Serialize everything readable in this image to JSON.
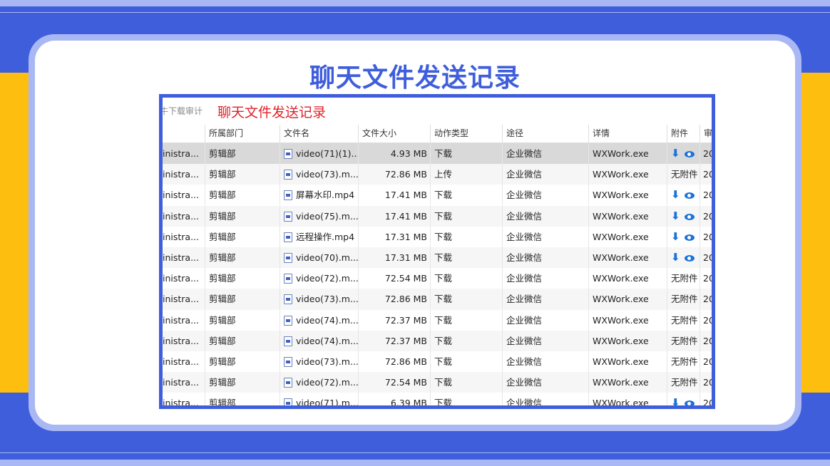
{
  "slide_title": "聊天文件发送记录",
  "app": {
    "breadcrumb": "牛下载审计",
    "annotation_label": "聊天文件发送记录"
  },
  "columns": [
    "",
    "所属部门",
    "文件名",
    "文件大小",
    "动作类型",
    "途径",
    "详情",
    "附件",
    "审"
  ],
  "rows": [
    {
      "user": "inistra...",
      "dept": "剪辑部",
      "file": "video(71)(1)....",
      "size": "4.93 MB",
      "action": "下载",
      "channel": "企业微信",
      "detail": "WXWork.exe",
      "attachment": "",
      "attachment_icons": true,
      "time": "20"
    },
    {
      "user": "inistra...",
      "dept": "剪辑部",
      "file": "video(73).m...",
      "size": "72.86 MB",
      "action": "上传",
      "channel": "企业微信",
      "detail": "WXWork.exe",
      "attachment": "无附件",
      "attachment_icons": false,
      "time": "20"
    },
    {
      "user": "inistra...",
      "dept": "剪辑部",
      "file": "屏幕水印.mp4",
      "size": "17.41 MB",
      "action": "下载",
      "channel": "企业微信",
      "detail": "WXWork.exe",
      "attachment": "",
      "attachment_icons": true,
      "time": "20"
    },
    {
      "user": "inistra...",
      "dept": "剪辑部",
      "file": "video(75).m...",
      "size": "17.41 MB",
      "action": "下载",
      "channel": "企业微信",
      "detail": "WXWork.exe",
      "attachment": "",
      "attachment_icons": true,
      "time": "20"
    },
    {
      "user": "inistra...",
      "dept": "剪辑部",
      "file": "远程操作.mp4",
      "size": "17.31 MB",
      "action": "下载",
      "channel": "企业微信",
      "detail": "WXWork.exe",
      "attachment": "",
      "attachment_icons": true,
      "time": "20"
    },
    {
      "user": "inistra...",
      "dept": "剪辑部",
      "file": "video(70).m...",
      "size": "17.31 MB",
      "action": "下载",
      "channel": "企业微信",
      "detail": "WXWork.exe",
      "attachment": "",
      "attachment_icons": true,
      "time": "20"
    },
    {
      "user": "inistra...",
      "dept": "剪辑部",
      "file": "video(72).m...",
      "size": "72.54 MB",
      "action": "下载",
      "channel": "企业微信",
      "detail": "WXWork.exe",
      "attachment": "无附件",
      "attachment_icons": false,
      "time": "20"
    },
    {
      "user": "inistra...",
      "dept": "剪辑部",
      "file": "video(73).m...",
      "size": "72.86 MB",
      "action": "下载",
      "channel": "企业微信",
      "detail": "WXWork.exe",
      "attachment": "无附件",
      "attachment_icons": false,
      "time": "20"
    },
    {
      "user": "inistra...",
      "dept": "剪辑部",
      "file": "video(74).m...",
      "size": "72.37 MB",
      "action": "下载",
      "channel": "企业微信",
      "detail": "WXWork.exe",
      "attachment": "无附件",
      "attachment_icons": false,
      "time": "20"
    },
    {
      "user": "inistra...",
      "dept": "剪辑部",
      "file": "video(74).m...",
      "size": "72.37 MB",
      "action": "下载",
      "channel": "企业微信",
      "detail": "WXWork.exe",
      "attachment": "无附件",
      "attachment_icons": false,
      "time": "20"
    },
    {
      "user": "inistra...",
      "dept": "剪辑部",
      "file": "video(73).m...",
      "size": "72.86 MB",
      "action": "下载",
      "channel": "企业微信",
      "detail": "WXWork.exe",
      "attachment": "无附件",
      "attachment_icons": false,
      "time": "20"
    },
    {
      "user": "inistra...",
      "dept": "剪辑部",
      "file": "video(72).m...",
      "size": "72.54 MB",
      "action": "下载",
      "channel": "企业微信",
      "detail": "WXWork.exe",
      "attachment": "无附件",
      "attachment_icons": false,
      "time": "20"
    },
    {
      "user": "inistra...",
      "dept": "剪辑部",
      "file": "video(71).m...",
      "size": "6.39 MB",
      "action": "下载",
      "channel": "企业微信",
      "detail": "WXWork.exe",
      "attachment": "",
      "attachment_icons": true,
      "time": "20"
    }
  ],
  "icons": {
    "download": "download-icon",
    "preview": "eye-icon",
    "file": "video-file-icon"
  },
  "colors": {
    "accent": "#3f5edb",
    "band": "#a9b8f4",
    "yellow": "#fdbe10",
    "red": "#e0222a",
    "icon_blue": "#1a73d9",
    "selected_row": "#d9d9d9"
  }
}
